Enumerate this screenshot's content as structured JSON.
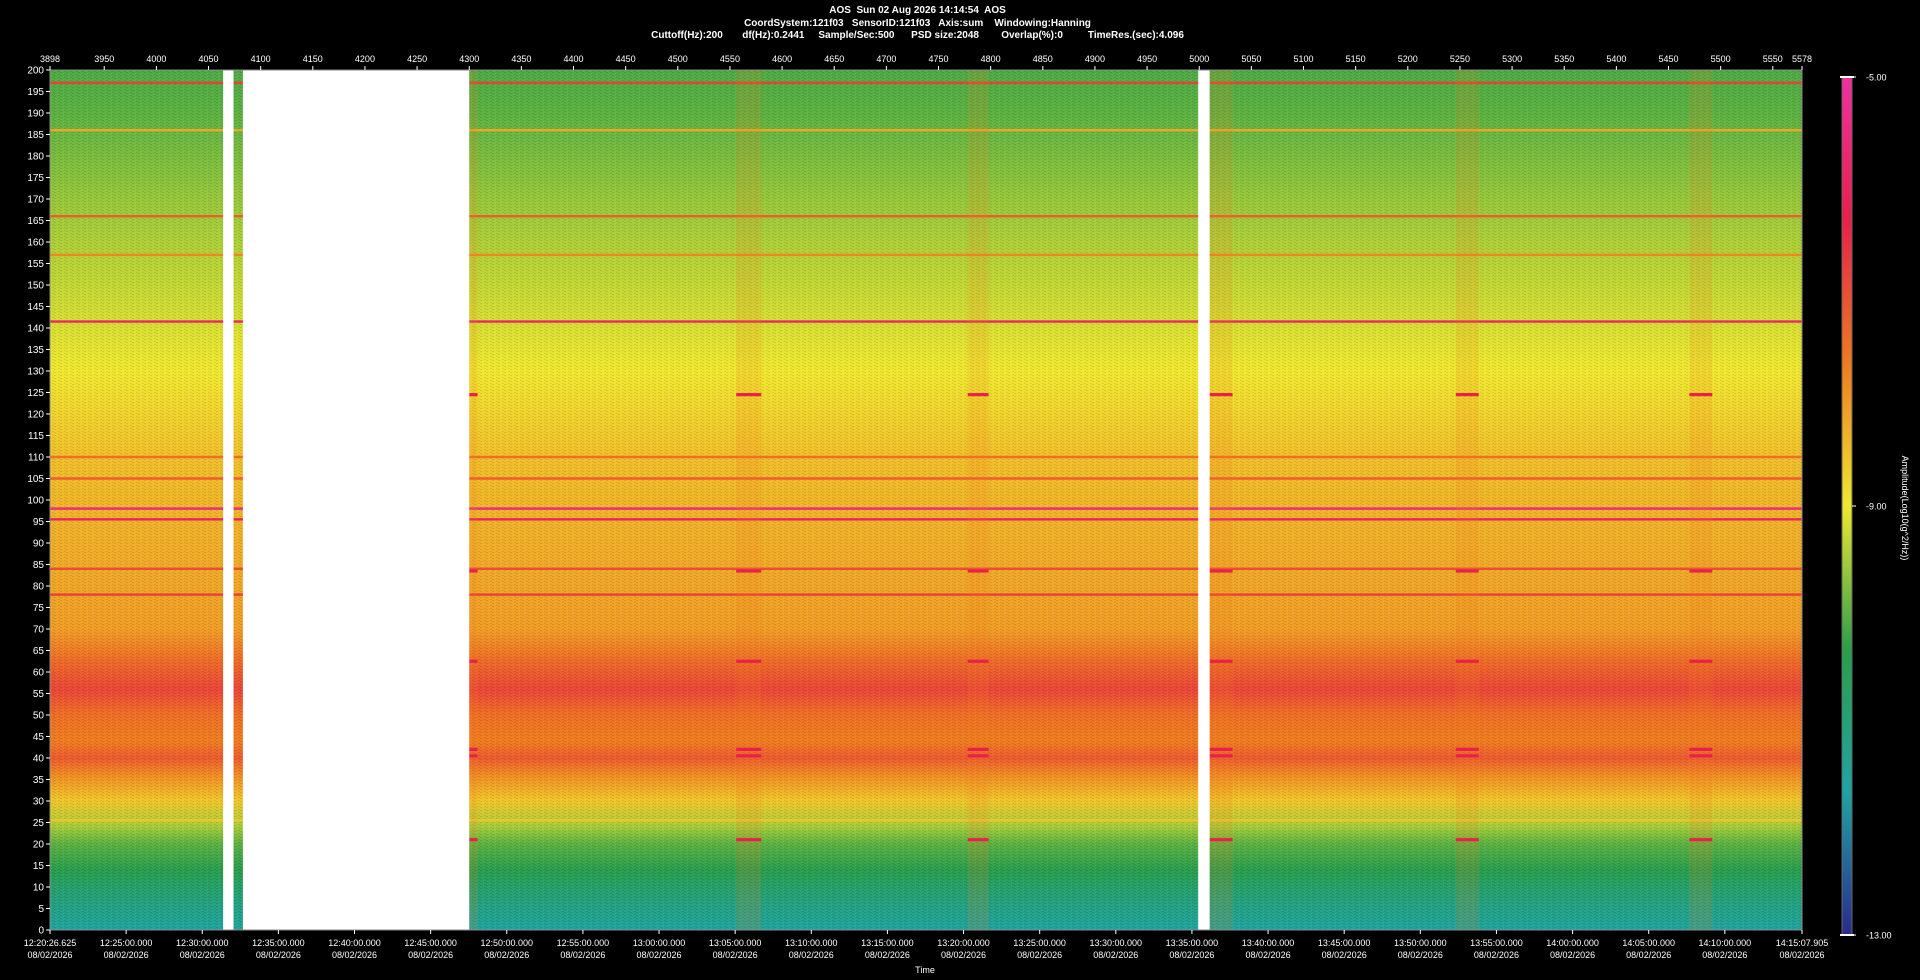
{
  "header": {
    "line1": "AOS  Sun 02 Aug 2026 14:14:54  AOS",
    "line2": "CoordSystem:121f03   SensorID:121f03   Axis:sum    Windowing:Hanning",
    "line3": "Cuttoff(Hz):200       df(Hz):0.2441     Sample/Sec:500      PSD size:2048        Overlap(%):0         TimeRes.(sec):4.096"
  },
  "chart_data": {
    "type": "heatmap",
    "xlabel": "Time",
    "ylabel": "",
    "colorbar_label": "Amplitude(Log10(g^2/Hz))",
    "colorbar_range": [
      -13.0,
      -5.0
    ],
    "colorbar_ticks": [
      "-5.00",
      "-9.00",
      "-13.00"
    ],
    "colormap": [
      "#2a2a8c",
      "#1fa4a4",
      "#2a9e48",
      "#f0e830",
      "#f07a20",
      "#e8204a",
      "#f030a0"
    ],
    "ylim": [
      0,
      200
    ],
    "y_ticks": [
      0,
      5,
      10,
      15,
      20,
      25,
      30,
      35,
      40,
      45,
      50,
      55,
      60,
      65,
      70,
      75,
      80,
      85,
      90,
      95,
      100,
      105,
      110,
      115,
      120,
      125,
      130,
      135,
      140,
      145,
      150,
      155,
      160,
      165,
      170,
      175,
      180,
      185,
      190,
      195,
      200
    ],
    "top_axis_range": [
      3898,
      5578
    ],
    "top_axis_ticks": [
      3898,
      3950,
      4000,
      4050,
      4100,
      4150,
      4200,
      4250,
      4300,
      4350,
      4400,
      4450,
      4500,
      4550,
      4600,
      4650,
      4700,
      4750,
      4800,
      4850,
      4900,
      4950,
      5000,
      5050,
      5100,
      5150,
      5200,
      5250,
      5300,
      5350,
      5400,
      5450,
      5500,
      5550,
      5578
    ],
    "time_ticks": [
      {
        "pos": 3898,
        "time": "12:20:26.625",
        "date": "08/02/2026"
      },
      {
        "pos": 3971,
        "time": "12:25:00.000",
        "date": "08/02/2026"
      },
      {
        "pos": 4044,
        "time": "12:30:00.000",
        "date": "08/02/2026"
      },
      {
        "pos": 4117,
        "time": "12:35:00.000",
        "date": "08/02/2026"
      },
      {
        "pos": 4190,
        "time": "12:40:00.000",
        "date": "08/02/2026"
      },
      {
        "pos": 4263,
        "time": "12:45:00.000",
        "date": "08/02/2026"
      },
      {
        "pos": 4336,
        "time": "12:50:00.000",
        "date": "08/02/2026"
      },
      {
        "pos": 4409,
        "time": "12:55:00.000",
        "date": "08/02/2026"
      },
      {
        "pos": 4482,
        "time": "13:00:00.000",
        "date": "08/02/2026"
      },
      {
        "pos": 4555,
        "time": "13:05:00.000",
        "date": "08/02/2026"
      },
      {
        "pos": 4628,
        "time": "13:10:00.000",
        "date": "08/02/2026"
      },
      {
        "pos": 4701,
        "time": "13:15:00.000",
        "date": "08/02/2026"
      },
      {
        "pos": 4774,
        "time": "13:20:00.000",
        "date": "08/02/2026"
      },
      {
        "pos": 4847,
        "time": "13:25:00.000",
        "date": "08/02/2026"
      },
      {
        "pos": 4920,
        "time": "13:30:00.000",
        "date": "08/02/2026"
      },
      {
        "pos": 4993,
        "time": "13:35:00.000",
        "date": "08/02/2026"
      },
      {
        "pos": 5066,
        "time": "13:40:00.000",
        "date": "08/02/2026"
      },
      {
        "pos": 5139,
        "time": "13:45:00.000",
        "date": "08/02/2026"
      },
      {
        "pos": 5212,
        "time": "13:50:00.000",
        "date": "08/02/2026"
      },
      {
        "pos": 5285,
        "time": "13:55:00.000",
        "date": "08/02/2026"
      },
      {
        "pos": 5358,
        "time": "14:00:00.000",
        "date": "08/02/2026"
      },
      {
        "pos": 5431,
        "time": "14:05:00.000",
        "date": "08/02/2026"
      },
      {
        "pos": 5504,
        "time": "14:10:00.000",
        "date": "08/02/2026"
      },
      {
        "pos": 5578,
        "time": "14:15:07.905",
        "date": "08/02/2026"
      }
    ],
    "gaps": [
      [
        4064,
        4074
      ],
      [
        4083,
        4300
      ],
      [
        4999,
        5010
      ]
    ],
    "spectral_lines_hz": [
      {
        "hz": 141.5,
        "level": -5.8
      },
      {
        "hz": 98.0,
        "level": -5.5
      },
      {
        "hz": 95.5,
        "level": -6.0
      },
      {
        "hz": 197.0,
        "level": -6.8
      },
      {
        "hz": 166.0,
        "level": -7.2
      },
      {
        "hz": 84.0,
        "level": -7.0
      },
      {
        "hz": 78.0,
        "level": -6.8
      },
      {
        "hz": 105.0,
        "level": -7.2
      },
      {
        "hz": 110.0,
        "level": -7.5
      },
      {
        "hz": 157.0,
        "level": -7.8
      },
      {
        "hz": 186.0,
        "level": -8.2
      },
      {
        "hz": 25.5,
        "level": -8.6
      }
    ],
    "band_profile": [
      {
        "hz": 0,
        "level": -11.6
      },
      {
        "hz": 8,
        "level": -11.0
      },
      {
        "hz": 14,
        "level": -10.4
      },
      {
        "hz": 20,
        "level": -10.0
      },
      {
        "hz": 24,
        "level": -9.5
      },
      {
        "hz": 30,
        "level": -8.6
      },
      {
        "hz": 36,
        "level": -7.9
      },
      {
        "hz": 40,
        "level": -7.2
      },
      {
        "hz": 44,
        "level": -7.7
      },
      {
        "hz": 50,
        "level": -7.5
      },
      {
        "hz": 56,
        "level": -6.9
      },
      {
        "hz": 62,
        "level": -7.4
      },
      {
        "hz": 70,
        "level": -8.1
      },
      {
        "hz": 90,
        "level": -8.3
      },
      {
        "hz": 110,
        "level": -8.5
      },
      {
        "hz": 130,
        "level": -9.0
      },
      {
        "hz": 150,
        "level": -9.3
      },
      {
        "hz": 170,
        "level": -9.6
      },
      {
        "hz": 190,
        "level": -10.0
      },
      {
        "hz": 200,
        "level": -10.1
      }
    ],
    "events": [
      {
        "start": 4300,
        "end": 4308
      },
      {
        "start": 4556,
        "end": 4580
      },
      {
        "start": 4778,
        "end": 4798
      },
      {
        "start": 5010,
        "end": 5032
      },
      {
        "start": 5246,
        "end": 5268
      },
      {
        "start": 5470,
        "end": 5492
      }
    ],
    "event_lines_hz": [
      124.5,
      83.5,
      62.5,
      42.0,
      40.5,
      21.0
    ]
  }
}
